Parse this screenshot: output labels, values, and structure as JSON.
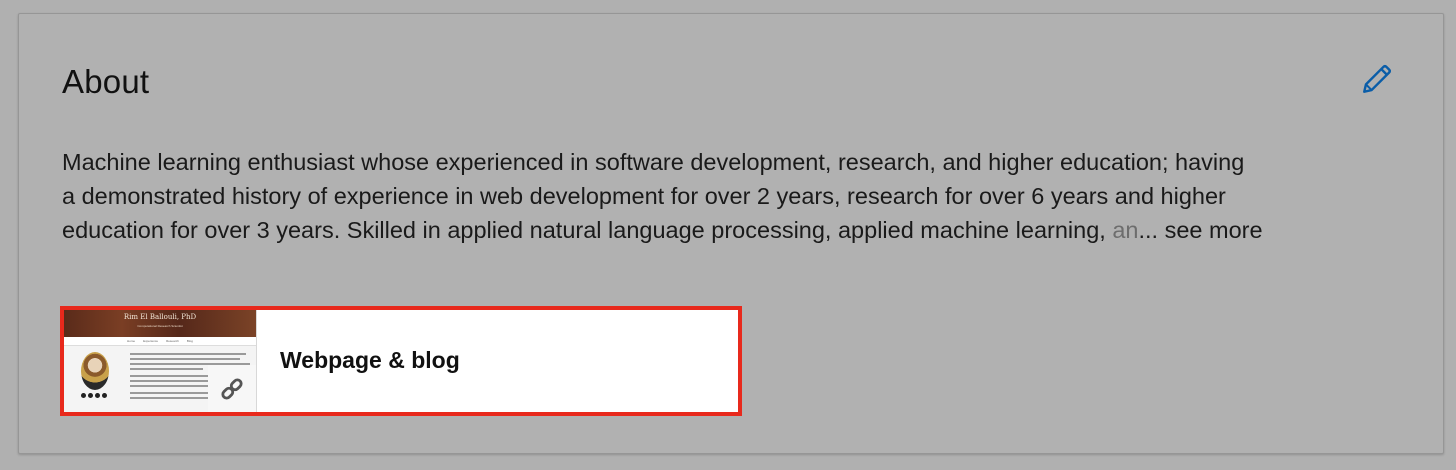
{
  "section": {
    "title": "About",
    "edit_icon": "pencil-icon",
    "summary_lines": [
      "Machine learning enthusiast whose experienced in software development, research, and higher education; having",
      "a demonstrated history of experience in web development for over 2 years, research for over 6 years and higher"
    ],
    "summary_line3_visible": "education for over 3 years. Skilled in applied natural language processing, applied machine learning, ",
    "summary_line3_faded": "an",
    "see_more_label": "... see more"
  },
  "media": {
    "title": "Webpage & blog",
    "link_icon": "link-icon",
    "highlight_color": "#e8291c",
    "thumbnail": {
      "site_title": "Rim El Ballouli, PhD",
      "site_subtitle": "Computational Research Scientist",
      "nav_items": [
        "Home",
        "Experience",
        "Research",
        "Blog"
      ]
    }
  }
}
